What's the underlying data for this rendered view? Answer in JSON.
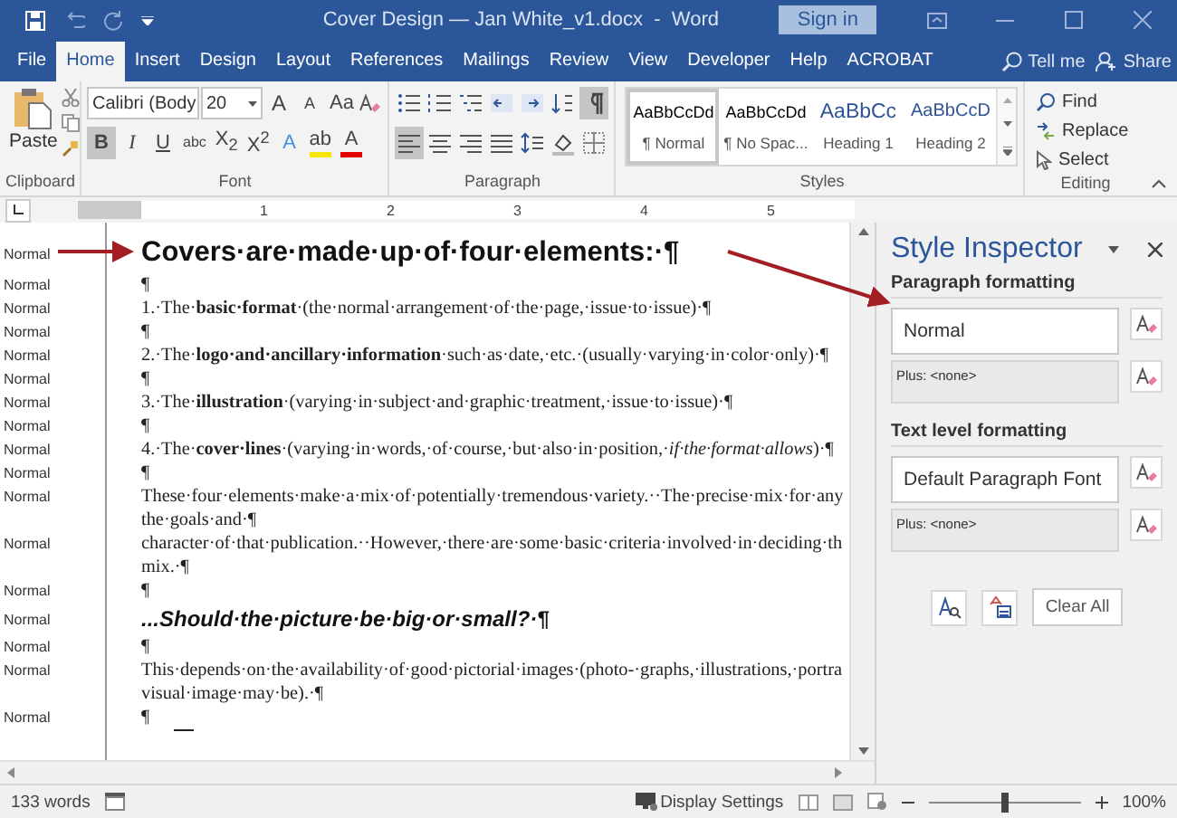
{
  "title_bar": {
    "title": "Cover Design — Jan White_v1.docx  -  Word",
    "sign_in": "Sign in"
  },
  "tabs": [
    {
      "label": "File",
      "selected": false
    },
    {
      "label": "Home",
      "selected": true
    },
    {
      "label": "Insert",
      "selected": false
    },
    {
      "label": "Design",
      "selected": false
    },
    {
      "label": "Layout",
      "selected": false
    },
    {
      "label": "References",
      "selected": false
    },
    {
      "label": "Mailings",
      "selected": false
    },
    {
      "label": "Review",
      "selected": false
    },
    {
      "label": "View",
      "selected": false
    },
    {
      "label": "Developer",
      "selected": false
    },
    {
      "label": "Help",
      "selected": false
    },
    {
      "label": "ACROBAT",
      "selected": false
    }
  ],
  "tell_me": "Tell me",
  "share": "Share",
  "ribbon": {
    "clipboard": {
      "paste": "Paste",
      "label": "Clipboard"
    },
    "font": {
      "name": "Calibri (Body",
      "size": "20",
      "label": "Font",
      "row1": [
        {
          "label": "A",
          "kind": "grow",
          "on": false
        },
        {
          "label": "A",
          "kind": "shrink",
          "on": false
        },
        {
          "label": "Aa",
          "kind": "case",
          "on": false
        }
      ],
      "row2": [
        {
          "label": "B",
          "kind": "bold",
          "on": true
        },
        {
          "label": "I",
          "kind": "italic",
          "on": false
        },
        {
          "label": "U",
          "kind": "underline",
          "on": false
        },
        {
          "label": "abc",
          "kind": "strike",
          "on": false
        },
        {
          "label": "X$_{2}$",
          "kind": "sub",
          "on": false
        },
        {
          "label": "X$^{2}$",
          "kind": "super",
          "on": false
        },
        {
          "label": "A",
          "kind": "effect",
          "on": false
        },
        {
          "label": "ab",
          "kind": "highlight",
          "on": false
        },
        {
          "label": "A",
          "kind": "color",
          "on": false
        }
      ]
    },
    "paragraph": {
      "label": "Paragraph",
      "row1": [
        {
          "kind": "bullets",
          "on": false
        },
        {
          "kind": "numbering",
          "on": false
        },
        {
          "kind": "multilevel",
          "on": false
        },
        {
          "kind": "outdent",
          "on": false
        },
        {
          "kind": "indent",
          "on": false
        },
        {
          "kind": "sort",
          "on": false
        },
        {
          "kind": "marks",
          "on": true
        }
      ],
      "row2": [
        {
          "kind": "left",
          "on": true
        },
        {
          "kind": "center",
          "on": false
        },
        {
          "kind": "right",
          "on": false
        },
        {
          "kind": "justify",
          "on": false
        },
        {
          "kind": "spacing",
          "on": false
        },
        {
          "kind": "shading",
          "on": false
        },
        {
          "kind": "borders",
          "on": false
        }
      ]
    },
    "styles": {
      "label": "Styles",
      "items": [
        {
          "preview": "AaBbCcDd",
          "name": "¶ Normal",
          "kind": "body",
          "selected": true
        },
        {
          "preview": "AaBbCcDd",
          "name": "¶ No Spac...",
          "kind": "body",
          "selected": false
        },
        {
          "preview": "AaBbCc",
          "name": "Heading 1",
          "kind": "heading1",
          "selected": false
        },
        {
          "preview": "AaBbCcD",
          "name": "Heading 2",
          "kind": "heading2",
          "selected": false
        }
      ]
    },
    "editing": {
      "label": "Editing",
      "items": [
        {
          "label": "Find",
          "kind": "find"
        },
        {
          "label": "Replace",
          "kind": "replace"
        },
        {
          "label": "Select",
          "kind": "select"
        }
      ]
    }
  },
  "ruler": {
    "numbers": [
      "1",
      "2",
      "3",
      "4",
      "5"
    ]
  },
  "document": {
    "paragraphs": [
      {
        "style": "Normal",
        "kind": "heading",
        "lines": [
          "Covers·are·made·up·of·four·elements:·¶"
        ]
      },
      {
        "style": "Normal",
        "kind": "body",
        "lines": [
          "¶"
        ]
      },
      {
        "style": "Normal",
        "kind": "body",
        "lines": [
          "1.·The·**basic·format**·(the·normal·arrangement·of·the·page,·issue·to·issue)·¶"
        ]
      },
      {
        "style": "Normal",
        "kind": "body",
        "lines": [
          "¶"
        ]
      },
      {
        "style": "Normal",
        "kind": "body",
        "lines": [
          "2.·The·**logo·and·ancillary·information**·such·as·date,·etc.·(usually·varying·in·color·only)·¶"
        ]
      },
      {
        "style": "Normal",
        "kind": "body",
        "lines": [
          "¶"
        ]
      },
      {
        "style": "Normal",
        "kind": "body",
        "lines": [
          "3.·The·**illustration**·(varying·in·subject·and·graphic·treatment,·issue·to·issue)·¶"
        ]
      },
      {
        "style": "Normal",
        "kind": "body",
        "lines": [
          "¶"
        ]
      },
      {
        "style": "Normal",
        "kind": "body",
        "lines": [
          "4.·The·**cover·lines**·(varying·in·words,·of·course,·but·also·in·position,·*if·the·format·allows*)·¶"
        ]
      },
      {
        "style": "Normal",
        "kind": "body",
        "lines": [
          "¶"
        ]
      },
      {
        "style": "Normal",
        "kind": "body",
        "lines": [
          "These·four·elements·make·a·mix·of·potentially·tremendous·variety.··The·precise·mix·for·any",
          "the·goals·and·¶"
        ]
      },
      {
        "style": "Normal",
        "kind": "body",
        "lines": [
          "character·of·that·publication.··However,·there·are·some·basic·criteria·involved·in·deciding·th",
          "mix.·¶"
        ]
      },
      {
        "style": "Normal",
        "kind": "body",
        "lines": [
          "¶"
        ]
      },
      {
        "style": "Normal",
        "kind": "subheading",
        "lines": [
          "...Should·the·picture·be·big·or·small?·¶"
        ]
      },
      {
        "style": "Normal",
        "kind": "body",
        "lines": [
          "¶"
        ]
      },
      {
        "style": "Normal",
        "kind": "body",
        "lines": [
          "This·depends·on·the·availability·of·good·pictorial·images·(photo-·graphs,·illustrations,·portra",
          "visual·image·may·be).·¶"
        ]
      },
      {
        "style": "Normal",
        "kind": "end",
        "lines": [
          "¶"
        ]
      }
    ]
  },
  "style_inspector": {
    "title": "Style Inspector",
    "sections": [
      {
        "heading": "Paragraph formatting",
        "style": "Normal",
        "plus": "Plus: <none>"
      },
      {
        "heading": "Text level formatting",
        "style": "Default Paragraph Font",
        "plus": "Plus: <none>"
      }
    ],
    "clear_all": "Clear All"
  },
  "status_bar": {
    "words": "133 words",
    "display_settings": "Display Settings",
    "zoom": {
      "level": 0.5,
      "reading": "100%"
    }
  }
}
